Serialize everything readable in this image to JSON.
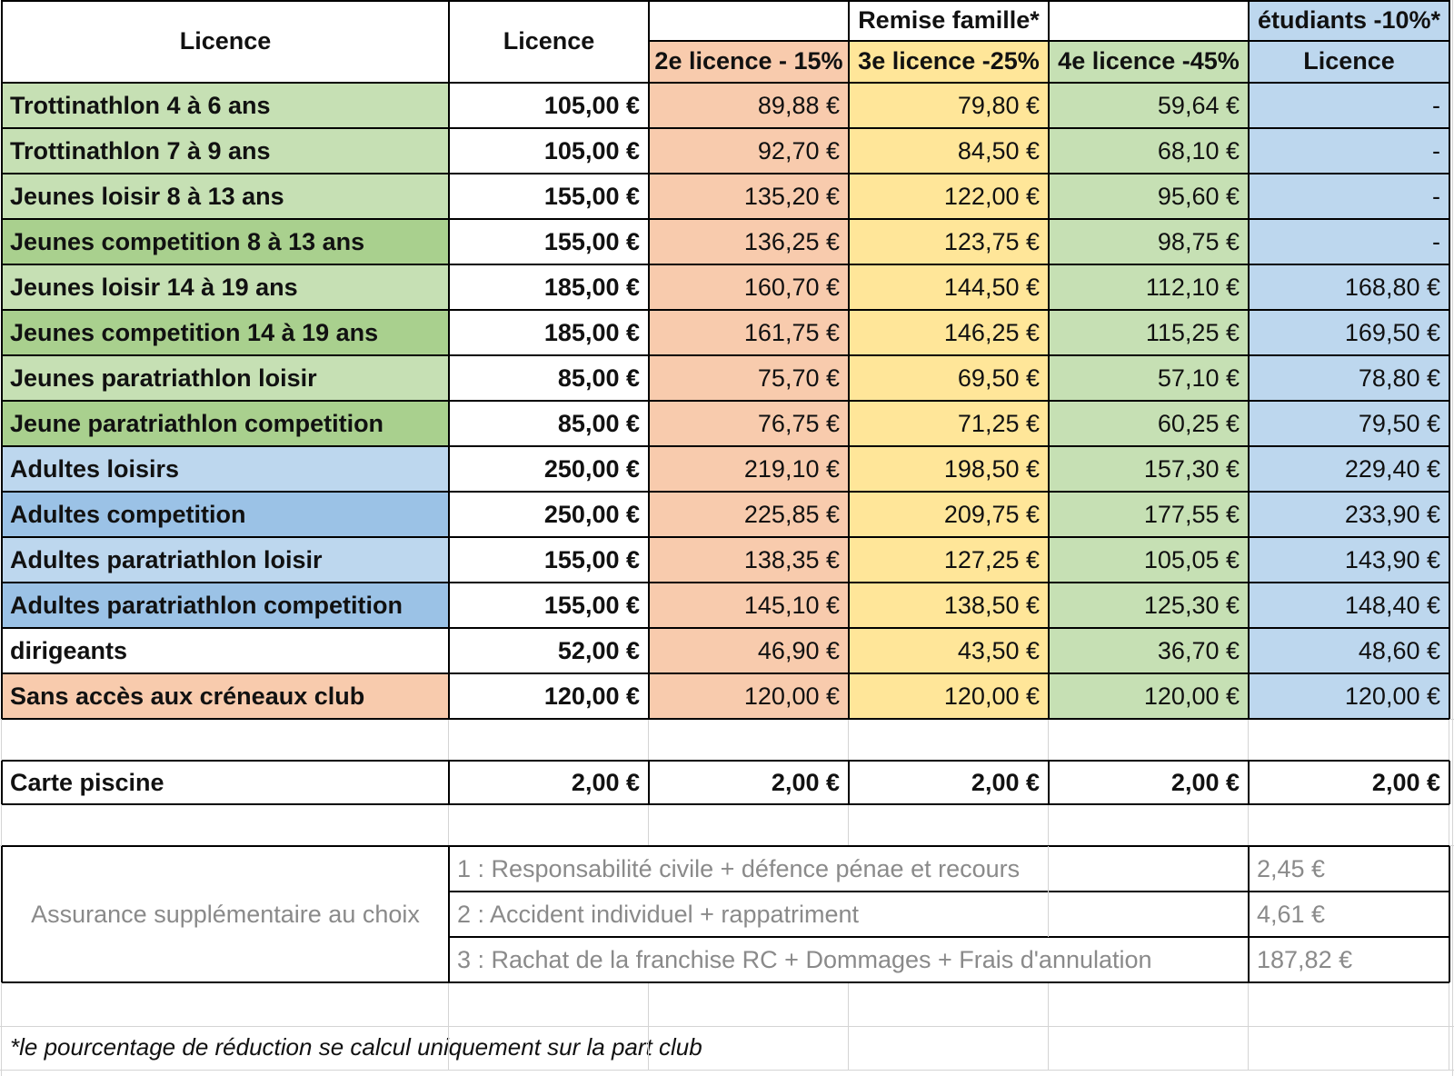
{
  "colors": {
    "green_light": "#c6e0b4",
    "green_dark": "#a9d08e",
    "blue_light": "#bdd7ee",
    "blue_dark": "#9bc2e6",
    "salmon": "#f8cbad",
    "yellow": "#ffe699",
    "white": "#ffffff"
  },
  "header": {
    "col1": "Licence",
    "col2": "Licence",
    "remise_famille": "Remise famille*",
    "remise_2e": "2e licence - 15%",
    "remise_3e": "3e licence -25%",
    "remise_4e": "4e licence -45%",
    "etudiants": "étudiants -10%*",
    "etudiants_licence": "Licence"
  },
  "rows": [
    {
      "label": "Trottinathlon 4 à 6 ans",
      "licence": "105,00 €",
      "r2": "89,88 €",
      "r3": "79,80 €",
      "r4": "59,64 €",
      "etudiant": "-",
      "label_color": "green_light",
      "etudiant_color": "blue_light"
    },
    {
      "label": "Trottinathlon 7 à 9 ans",
      "licence": "105,00 €",
      "r2": "92,70 €",
      "r3": "84,50 €",
      "r4": "68,10 €",
      "etudiant": "-",
      "label_color": "green_light",
      "etudiant_color": "blue_light"
    },
    {
      "label": "Jeunes loisir 8 à 13 ans",
      "licence": "155,00 €",
      "r2": "135,20 €",
      "r3": "122,00 €",
      "r4": "95,60 €",
      "etudiant": "-",
      "label_color": "green_light",
      "etudiant_color": "blue_light"
    },
    {
      "label": "Jeunes competition 8 à 13 ans",
      "licence": "155,00 €",
      "r2": "136,25 €",
      "r3": "123,75 €",
      "r4": "98,75 €",
      "etudiant": "-",
      "label_color": "green_dark",
      "etudiant_color": "blue_light"
    },
    {
      "label": "Jeunes loisir 14 à 19 ans",
      "licence": "185,00 €",
      "r2": "160,70 €",
      "r3": "144,50 €",
      "r4": "112,10 €",
      "etudiant": "168,80 €",
      "label_color": "green_light",
      "etudiant_color": "blue_light"
    },
    {
      "label": "Jeunes competition 14 à 19 ans",
      "licence": "185,00 €",
      "r2": "161,75 €",
      "r3": "146,25 €",
      "r4": "115,25 €",
      "etudiant": "169,50 €",
      "label_color": "green_dark",
      "etudiant_color": "blue_light"
    },
    {
      "label": "Jeunes paratriathlon loisir",
      "licence": "85,00 €",
      "r2": "75,70 €",
      "r3": "69,50 €",
      "r4": "57,10 €",
      "etudiant": "78,80 €",
      "label_color": "green_light",
      "etudiant_color": "blue_light"
    },
    {
      "label": "Jeune paratriathlon competition",
      "licence": "85,00 €",
      "r2": "76,75 €",
      "r3": "71,25 €",
      "r4": "60,25 €",
      "etudiant": "79,50 €",
      "label_color": "green_dark",
      "etudiant_color": "blue_light"
    },
    {
      "label": "Adultes loisirs",
      "licence": "250,00 €",
      "r2": "219,10 €",
      "r3": "198,50 €",
      "r4": "157,30 €",
      "etudiant": "229,40 €",
      "label_color": "blue_light",
      "etudiant_color": "blue_light"
    },
    {
      "label": "Adultes competition",
      "licence": "250,00 €",
      "r2": "225,85 €",
      "r3": "209,75 €",
      "r4": "177,55 €",
      "etudiant": "233,90 €",
      "label_color": "blue_dark",
      "etudiant_color": "blue_light"
    },
    {
      "label": "Adultes paratriathlon loisir",
      "licence": "155,00 €",
      "r2": "138,35 €",
      "r3": "127,25 €",
      "r4": "105,05 €",
      "etudiant": "143,90 €",
      "label_color": "blue_light",
      "etudiant_color": "blue_light"
    },
    {
      "label": "Adultes paratriathlon competition",
      "licence": "155,00 €",
      "r2": "145,10 €",
      "r3": "138,50 €",
      "r4": "125,30 €",
      "etudiant": "148,40 €",
      "label_color": "blue_dark",
      "etudiant_color": "blue_light"
    },
    {
      "label": "dirigeants",
      "licence": "52,00 €",
      "r2": "46,90 €",
      "r3": "43,50 €",
      "r4": "36,70 €",
      "etudiant": "48,60 €",
      "label_color": "white",
      "etudiant_color": "blue_light"
    },
    {
      "label": "Sans accès aux créneaux club",
      "licence": "120,00 €",
      "r2": "120,00 €",
      "r3": "120,00 €",
      "r4": "120,00 €",
      "etudiant": "120,00 €",
      "label_color": "salmon",
      "etudiant_color": "blue_light"
    }
  ],
  "piscine": {
    "label": "Carte piscine",
    "values": [
      "2,00 €",
      "2,00 €",
      "2,00 €",
      "2,00 €",
      "2,00 €"
    ]
  },
  "assurance": {
    "label": "Assurance supplémentaire au choix",
    "options": [
      {
        "text": "1 : Responsabilité civile + défence pénae et recours",
        "price": "2,45 €"
      },
      {
        "text": "2 : Accident individuel + rappatriment",
        "price": "4,61 €"
      },
      {
        "text": "3 : Rachat de la franchise RC + Dommages + Frais d'annulation",
        "price": "187,82 €"
      }
    ]
  },
  "footnote": "*le pourcentage de réduction se calcul uniquement sur la part club"
}
